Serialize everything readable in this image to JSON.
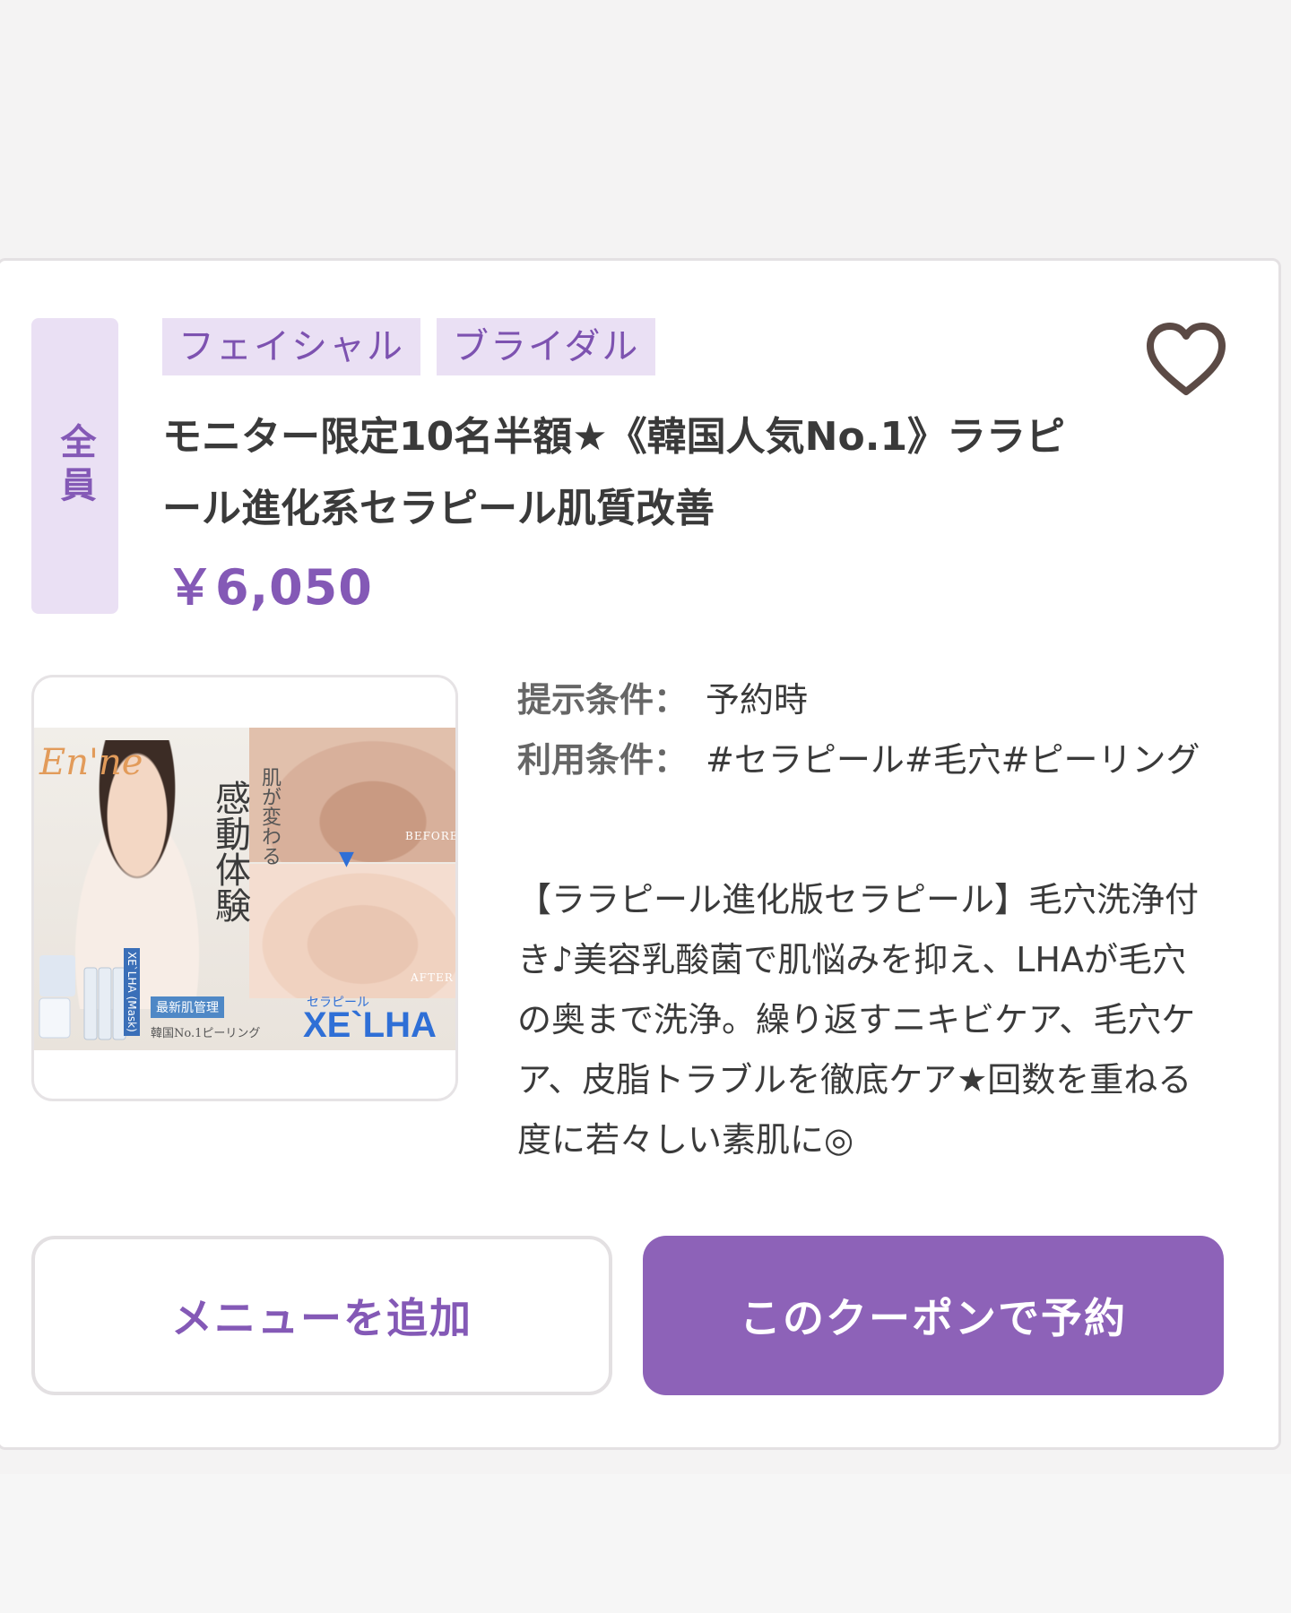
{
  "coupon": {
    "target_badge": "全員",
    "tags": [
      "フェイシャル",
      "ブライダル"
    ],
    "title": "モニター限定10名半額★《韓国人気No.1》ララピール進化系セラピール肌質改善",
    "price": "￥6,050",
    "favorite_icon": "heart-outline-icon",
    "image": {
      "brand_script": "En'ne",
      "headline": "感動体験",
      "subhead": "肌が変わる",
      "before_label": "BEFORE",
      "after_label": "AFTER",
      "new_tag": "最新肌管理",
      "caption": "韓国No.1ピーリング",
      "product_small": "セラピール",
      "product_logo": "XE`LHA",
      "bottle_label": "XE`LHA (Mask)"
    },
    "conditions": [
      {
        "label": "提示条件：",
        "value": "予約時"
      },
      {
        "label": "利用条件：",
        "value": "#セラピール#毛穴#ピーリング"
      }
    ],
    "description": "【ララピール進化版セラピール】毛穴洗浄付き♪美容乳酸菌で肌悩みを抑え、LHAが毛穴の奥まで洗浄。繰り返すニキビケア、毛穴ケア、皮脂トラブルを徹底ケア★回数を重ねる度に若々しい素肌に◎",
    "buttons": {
      "add_menu": "メニューを追加",
      "reserve": "このクーポンで予約"
    }
  },
  "colors": {
    "accent": "#8459b6",
    "accent_light": "#eae0f4",
    "button_primary": "#8d62b8",
    "heart": "#5b4a45"
  }
}
